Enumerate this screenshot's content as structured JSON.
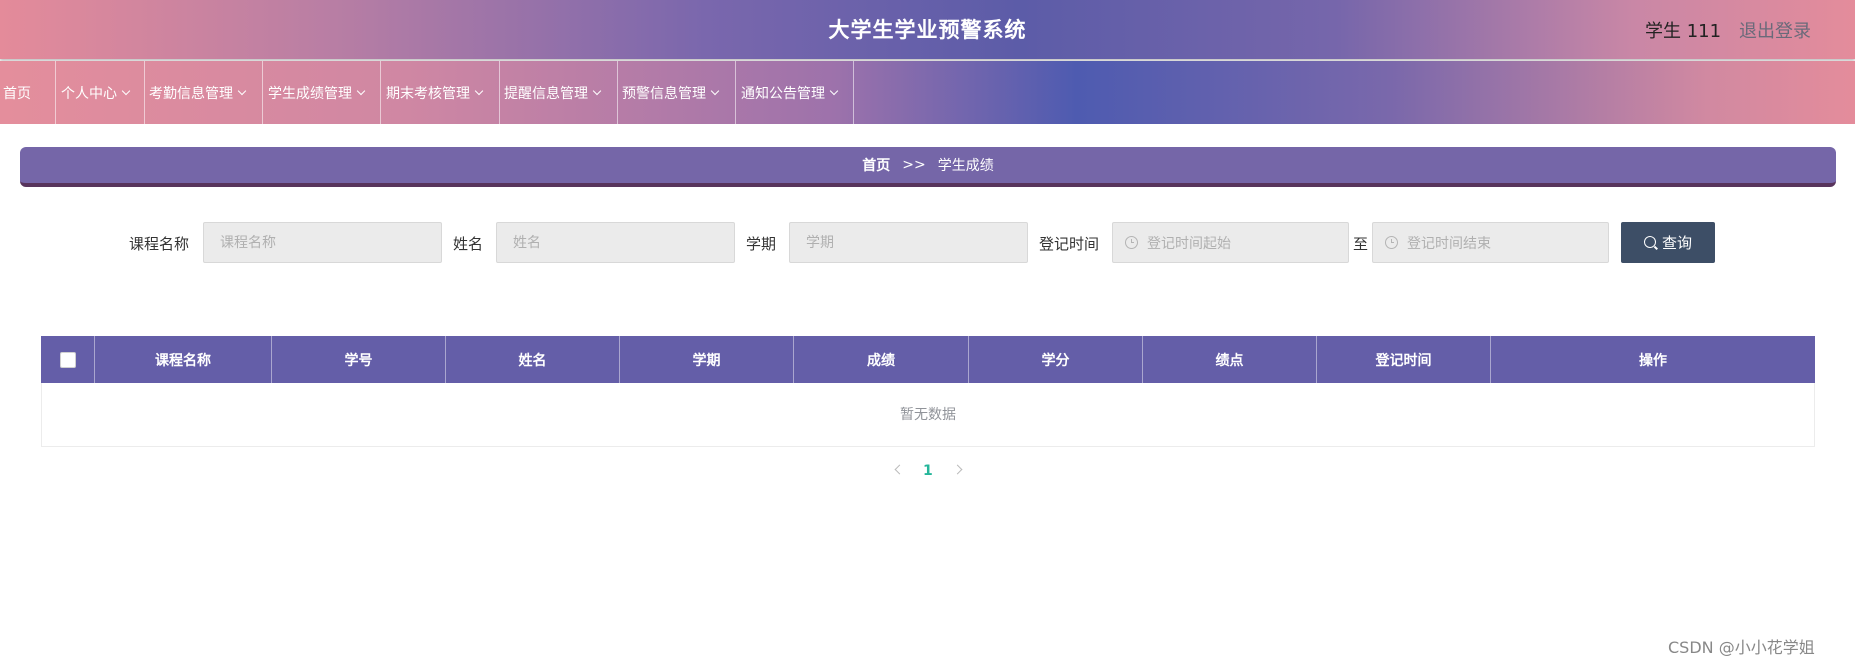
{
  "header": {
    "title": "大学生学业预警系统",
    "user": "学生 111",
    "logout": "退出登录"
  },
  "nav": [
    {
      "label": "首页"
    },
    {
      "label": "个人中心"
    },
    {
      "label": "考勤信息管理"
    },
    {
      "label": "学生成绩管理"
    },
    {
      "label": "期末考核管理"
    },
    {
      "label": "提醒信息管理"
    },
    {
      "label": "预警信息管理"
    },
    {
      "label": "通知公告管理"
    }
  ],
  "breadcrumb": {
    "home": "首页",
    "separator": ">>",
    "current": "学生成绩"
  },
  "search": {
    "course_label": "课程名称",
    "course_placeholder": "课程名称",
    "name_label": "姓名",
    "name_placeholder": "姓名",
    "term_label": "学期",
    "term_placeholder": "学期",
    "date_label": "登记时间",
    "date_start_placeholder": "登记时间起始",
    "date_to": "至",
    "date_end_placeholder": "登记时间结束",
    "query_button": "查询"
  },
  "table": {
    "columns": [
      "课程名称",
      "学号",
      "姓名",
      "学期",
      "成绩",
      "学分",
      "绩点",
      "登记时间",
      "操作"
    ],
    "empty_text": "暂无数据"
  },
  "pagination": {
    "current_page": "1"
  },
  "watermark": "CSDN @小小花学姐",
  "colors": {
    "table_header": "#645ea8",
    "breadcrumb_bar": "#7566a8",
    "query_button": "#3d4e66",
    "active_page": "#25b69a"
  }
}
